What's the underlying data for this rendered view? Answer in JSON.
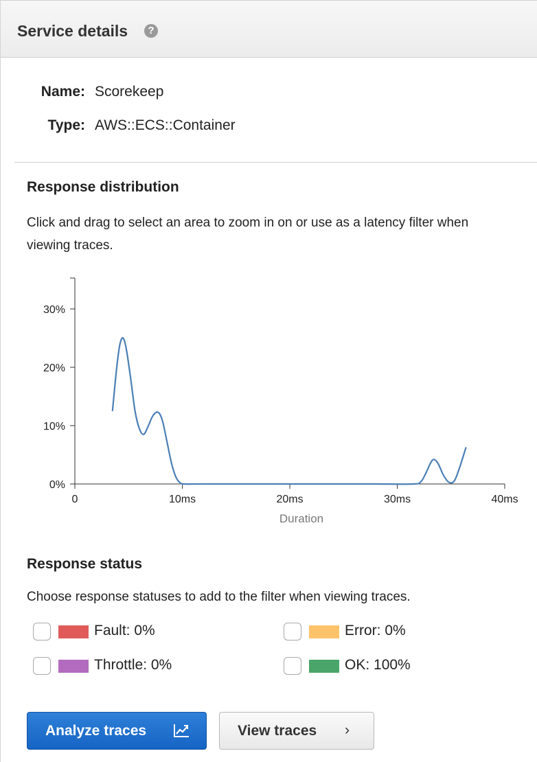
{
  "panel": {
    "title": "Service details",
    "help_icon": "question-circle-icon"
  },
  "details": {
    "name_label": "Name:",
    "name_value": "Scorekeep",
    "type_label": "Type:",
    "type_value": "AWS::ECS::Container"
  },
  "distribution": {
    "title": "Response distribution",
    "description_line1": "Click and drag to select an area to zoom in on or use as a latency filter when",
    "description_line2": "viewing traces."
  },
  "chart_data": {
    "type": "line",
    "xlabel": "Duration",
    "ylabel": "",
    "xlim": [
      0,
      40
    ],
    "ylim": [
      0,
      35
    ],
    "x_ticks": [
      {
        "value": 0,
        "label": "0"
      },
      {
        "value": 10,
        "label": "10ms"
      },
      {
        "value": 20,
        "label": "20ms"
      },
      {
        "value": 30,
        "label": "30ms"
      },
      {
        "value": 40,
        "label": "40ms"
      }
    ],
    "y_ticks": [
      {
        "value": 0,
        "label": "0%"
      },
      {
        "value": 10,
        "label": "10%"
      },
      {
        "value": 20,
        "label": "20%"
      },
      {
        "value": 30,
        "label": "30%"
      }
    ],
    "series": [
      {
        "color": "#4a7fb5",
        "x": [
          3.5,
          3.9,
          4.2,
          4.5,
          4.8,
          5.2,
          5.6,
          6.0,
          6.4,
          6.8,
          7.2,
          7.6,
          7.9,
          8.2,
          8.6,
          9.0,
          9.4,
          9.8,
          10.2,
          12,
          16,
          20,
          24,
          28,
          31.5,
          32.2,
          32.7,
          33.1,
          33.4,
          33.8,
          34.3,
          34.8,
          35.3,
          35.8,
          36.4
        ],
        "y": [
          12.5,
          20,
          24,
          25,
          23,
          18,
          12.5,
          9.5,
          8.5,
          9.8,
          11.5,
          12.3,
          12,
          10.5,
          7,
          3.5,
          1.2,
          0.2,
          0,
          0,
          0,
          0,
          0,
          0,
          0,
          0.4,
          2,
          3.6,
          4.2,
          3.5,
          1.5,
          0.3,
          0.5,
          2.8,
          6.3
        ]
      }
    ]
  },
  "status": {
    "title": "Response status",
    "description": "Choose response statuses to add to the filter when viewing traces.",
    "items": [
      {
        "label": "Fault: 0%",
        "color": "#e05a5a"
      },
      {
        "label": "Error: 0%",
        "color": "#fdc36b"
      },
      {
        "label": "Throttle: 0%",
        "color": "#b36bbf"
      },
      {
        "label": "OK: 100%",
        "color": "#4aa56b"
      }
    ]
  },
  "actions": {
    "analyze_label": "Analyze traces",
    "analyze_icon": "line-chart-icon",
    "view_label": "View traces",
    "view_icon": "chevron-right-icon"
  }
}
